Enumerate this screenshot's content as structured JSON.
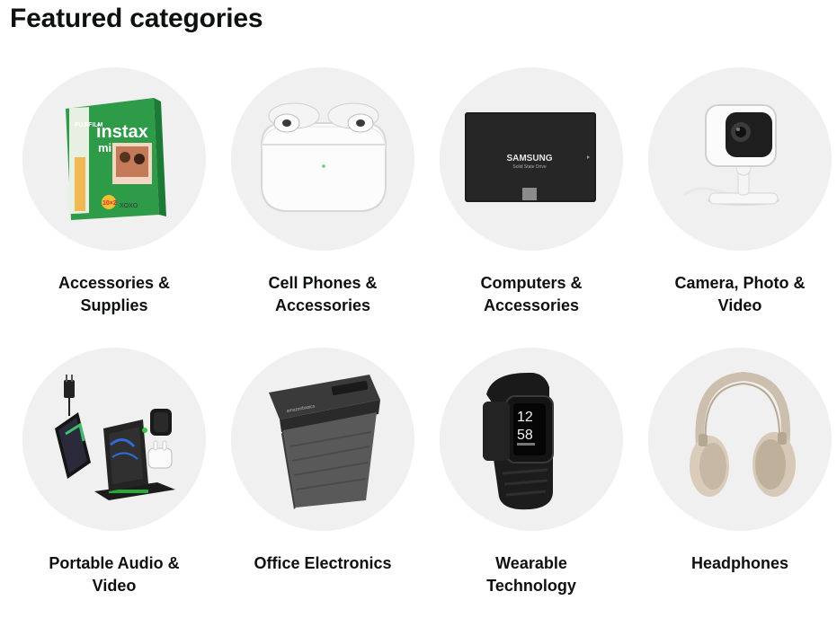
{
  "page": {
    "title": "Featured categories"
  },
  "categories": [
    {
      "lines": [
        "Accessories &",
        "Supplies"
      ],
      "icon": "instant-film-icon"
    },
    {
      "lines": [
        "Cell Phones &",
        "Accessories"
      ],
      "icon": "earbuds-case-icon"
    },
    {
      "lines": [
        "Computers &",
        "Accessories"
      ],
      "icon": "ssd-drive-icon"
    },
    {
      "lines": [
        "Camera, Photo &",
        "Video"
      ],
      "icon": "security-camera-icon"
    },
    {
      "lines": [
        "Portable Audio &",
        "Video"
      ],
      "icon": "wireless-charger-icon"
    },
    {
      "lines": [
        "Office Electronics"
      ],
      "icon": "paper-shredder-icon"
    },
    {
      "lines": [
        "Wearable",
        "Technology"
      ],
      "icon": "fitness-tracker-icon"
    },
    {
      "lines": [
        "Headphones"
      ],
      "icon": "headphones-icon"
    }
  ],
  "product_text": {
    "film_brand": "FUJIFILM",
    "film_name": "instax",
    "film_sub": "mini",
    "film_pack": "10×2",
    "film_note": "XOXO",
    "ssd_brand": "SAMSUNG",
    "ssd_sub": "Solid State Drive",
    "tracker_hour": "12",
    "tracker_min": "58",
    "shredder_brand": "amazonbasics"
  }
}
